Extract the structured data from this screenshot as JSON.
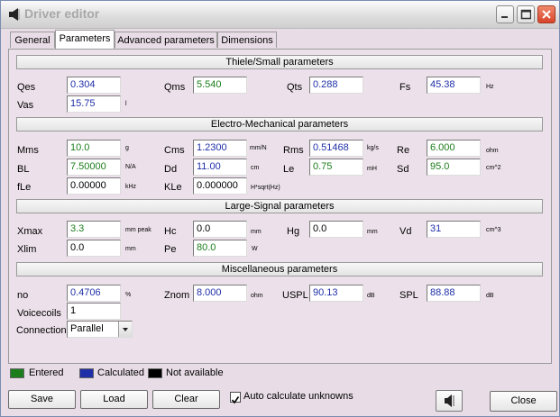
{
  "window": {
    "title": "Driver editor"
  },
  "tabs": [
    {
      "label": "General"
    },
    {
      "label": "Parameters"
    },
    {
      "label": "Advanced parameters"
    },
    {
      "label": "Dimensions"
    }
  ],
  "sections": {
    "thiele": "Thiele/Small parameters",
    "electro": "Electro-Mechanical parameters",
    "large": "Large-Signal parameters",
    "misc": "Miscellaneous parameters"
  },
  "params": {
    "qes": {
      "label": "Qes",
      "value": "0.304",
      "unit": ""
    },
    "qms": {
      "label": "Qms",
      "value": "5.540",
      "unit": ""
    },
    "qts": {
      "label": "Qts",
      "value": "0.288",
      "unit": ""
    },
    "fs": {
      "label": "Fs",
      "value": "45.38",
      "unit": "Hz"
    },
    "vas": {
      "label": "Vas",
      "value": "15.75",
      "unit": "l"
    },
    "mms": {
      "label": "Mms",
      "value": "10.0",
      "unit": "g"
    },
    "cms": {
      "label": "Cms",
      "value": "1.2300",
      "unit": "mm/N"
    },
    "rms": {
      "label": "Rms",
      "value": "0.51468",
      "unit": "kg/s"
    },
    "re": {
      "label": "Re",
      "value": "6.000",
      "unit": "ohm"
    },
    "bl": {
      "label": "BL",
      "value": "7.50000",
      "unit": "N/A"
    },
    "dd": {
      "label": "Dd",
      "value": "11.00",
      "unit": "cm"
    },
    "le": {
      "label": "Le",
      "value": "0.75",
      "unit": "mH"
    },
    "sd": {
      "label": "Sd",
      "value": "95.0",
      "unit": "cm^2"
    },
    "fle": {
      "label": "fLe",
      "value": "0.00000",
      "unit": "kHz"
    },
    "kle": {
      "label": "KLe",
      "value": "0.000000",
      "unit": "H*sqrt(Hz)"
    },
    "xmax": {
      "label": "Xmax",
      "value": "3.3",
      "unit": "mm  peak"
    },
    "hc": {
      "label": "Hc",
      "value": "0.0",
      "unit": "mm"
    },
    "hg": {
      "label": "Hg",
      "value": "0.0",
      "unit": "mm"
    },
    "vd": {
      "label": "Vd",
      "value": "31",
      "unit": "cm^3"
    },
    "xlim": {
      "label": "Xlim",
      "value": "0.0",
      "unit": "mm"
    },
    "pe": {
      "label": "Pe",
      "value": "80.0",
      "unit": "W"
    },
    "no": {
      "label": "no",
      "value": "0.4706",
      "unit": "%"
    },
    "znom": {
      "label": "Znom",
      "value": "8.000",
      "unit": "ohm"
    },
    "uspl": {
      "label": "USPL",
      "value": "90.13",
      "unit": "dB"
    },
    "spl": {
      "label": "SPL",
      "value": "88.88",
      "unit": "dB"
    },
    "voicecoils": {
      "label": "Voicecoils",
      "value": "1"
    },
    "connection": {
      "label": "Connection",
      "value": "Parallel"
    }
  },
  "legend": {
    "entered": {
      "label": "Entered",
      "color": "#1c7d1c"
    },
    "calculated": {
      "label": "Calculated",
      "color": "#1f2fa8"
    },
    "na": {
      "label": "Not available",
      "color": "#000000"
    }
  },
  "buttons": {
    "save": "Save",
    "load": "Load",
    "clear": "Clear",
    "auto_calc": "Auto calculate unknowns",
    "close": "Close"
  }
}
